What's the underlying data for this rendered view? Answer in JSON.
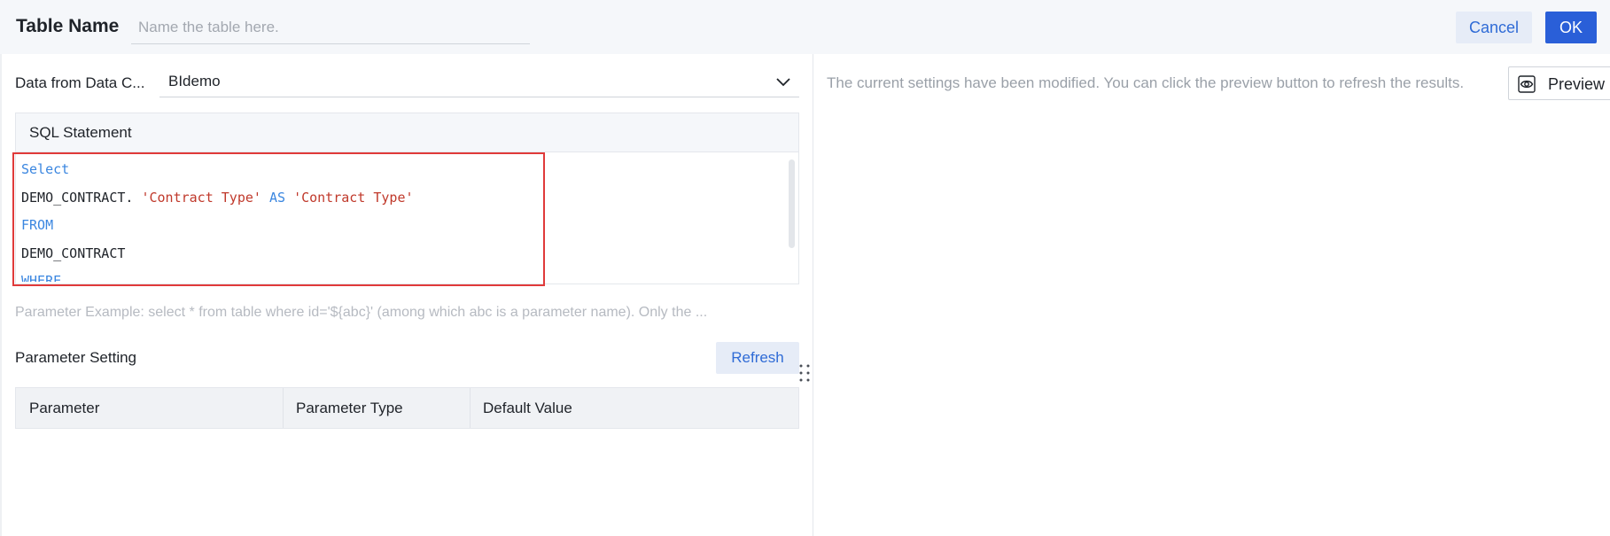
{
  "header": {
    "title": "Table Name",
    "name_placeholder": "Name the table here.",
    "cancel_label": "Cancel",
    "ok_label": "OK"
  },
  "data_source": {
    "label": "Data from Data C...",
    "selected": "BIdemo",
    "icon": "chevron-down-icon"
  },
  "sql": {
    "title": "SQL Statement",
    "lines": [
      [
        {
          "t": "Select",
          "c": "kw"
        }
      ],
      [
        {
          "t": "DEMO_CONTRACT. ",
          "c": "plain"
        },
        {
          "t": "'Contract Type'",
          "c": "str"
        },
        {
          "t": " ",
          "c": "plain"
        },
        {
          "t": "AS",
          "c": "kw"
        },
        {
          "t": " ",
          "c": "plain"
        },
        {
          "t": "'Contract Type'",
          "c": "str"
        }
      ],
      [
        {
          "t": "FROM",
          "c": "kw"
        }
      ],
      [
        {
          "t": "DEMO_CONTRACT",
          "c": "plain"
        }
      ],
      [
        {
          "t": "WHERE",
          "c": "kw"
        }
      ]
    ],
    "highlight_color": "#e03a3a"
  },
  "param_hint": "Parameter Example: select * from table where id='${abc}' (among which abc is a parameter name). Only the ...",
  "param_setting": {
    "label": "Parameter Setting",
    "refresh_label": "Refresh",
    "columns": [
      "Parameter",
      "Parameter Type",
      "Default Value"
    ]
  },
  "preview": {
    "message": "The current settings have been modified. You can click the preview button to refresh the results.",
    "button_label": "Preview",
    "icon": "eye-icon"
  },
  "colors": {
    "primary": "#2a5fd8",
    "keyword": "#3a86e0",
    "string": "#c0392b"
  }
}
